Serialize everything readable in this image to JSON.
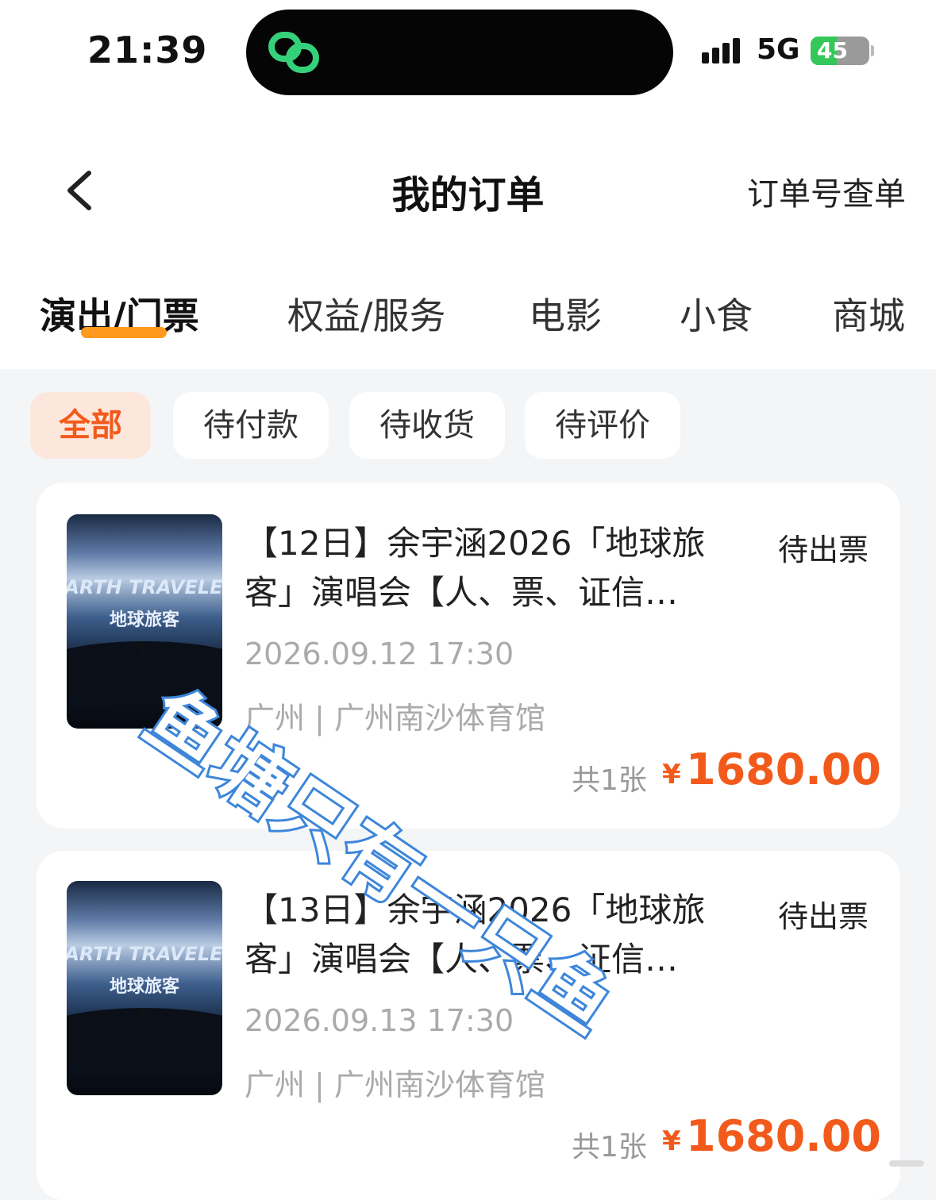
{
  "status_bar": {
    "time": "21:39",
    "network": "5G",
    "battery_level": "45",
    "battery_fraction": 0.45,
    "icons": [
      "island-app-icon",
      "signal-icon",
      "battery-icon"
    ]
  },
  "nav": {
    "back_icon": "chevron-left-icon",
    "title": "我的订单",
    "right_action": "订单号查单"
  },
  "category_tabs": [
    {
      "label": "演出/门票",
      "active": true
    },
    {
      "label": "权益/服务",
      "active": false
    },
    {
      "label": "电影",
      "active": false
    },
    {
      "label": "小食",
      "active": false
    },
    {
      "label": "商城",
      "active": false
    }
  ],
  "filter_chips": [
    {
      "label": "全部",
      "active": true
    },
    {
      "label": "待付款",
      "active": false
    },
    {
      "label": "待收货",
      "active": false
    },
    {
      "label": "待评价",
      "active": false
    }
  ],
  "orders": [
    {
      "title_line1": "【12日】余宇涵2026「地球旅",
      "title_line2": "客」演唱会【人、票、证信…",
      "status": "待出票",
      "date": "2026.09.12 17:30",
      "venue": "广州 | 广州南沙体育馆",
      "quantity": "共1张",
      "currency": "¥",
      "price": "1680.00",
      "poster_title": "EARTH TRAVELER",
      "poster_subtitle": "地球旅客"
    },
    {
      "title_line1": "【13日】余宇涵2026「地球旅",
      "title_line2": "客」演唱会【人、票、证信…",
      "status": "待出票",
      "date": "2026.09.13 17:30",
      "venue": "广州 | 广州南沙体育馆",
      "quantity": "共1张",
      "currency": "¥",
      "price": "1680.00",
      "poster_title": "EARTH TRAVELER",
      "poster_subtitle": "地球旅客"
    }
  ],
  "watermark": "鱼塘只有一只鱼",
  "colors": {
    "accent": "#f25a1b",
    "tab_indicator": "#ff9a1e",
    "chip_active_bg": "#fde7dd",
    "background": "#f4f5f7",
    "watermark_stroke": "#3d86da"
  }
}
